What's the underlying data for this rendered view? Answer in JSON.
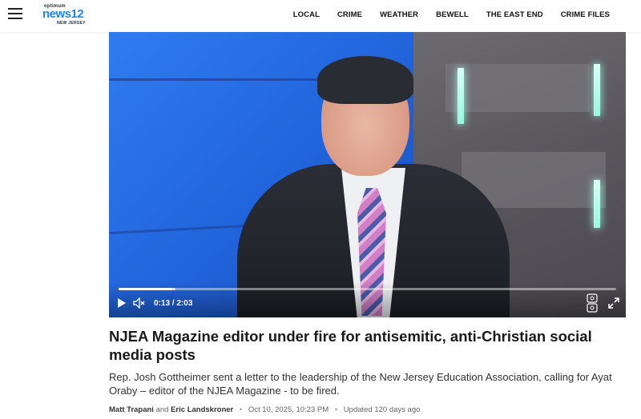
{
  "header": {
    "logo_top": "optimum",
    "logo_main": "news12",
    "logo_sub": "NEW JERSEY",
    "nav": [
      "LOCAL",
      "CRIME",
      "WEATHER",
      "BEWELL",
      "THE EAST END",
      "CRIME FILES"
    ]
  },
  "video": {
    "current_time": "0:13",
    "duration": "2:03",
    "progress_fraction": 0.106,
    "buffer_fraction": 0.115
  },
  "article": {
    "headline": "NJEA Magazine editor under fire for antisemitic, anti-Christian social media posts",
    "summary": "Rep. Josh Gottheimer sent a letter to the leadership of the New Jersey Education Association, calling for Ayat Oraby – editor of the NJEA Magazine - to be fired.",
    "author1": "Matt Trapani",
    "and": "and",
    "author2": "Eric Landskroner",
    "date": "Oct 10, 2025, 10:23 PM",
    "updated": "Updated 120 days ago"
  },
  "colors": {
    "brand_blue": "#1e88e5",
    "navy": "#1f2a44"
  }
}
